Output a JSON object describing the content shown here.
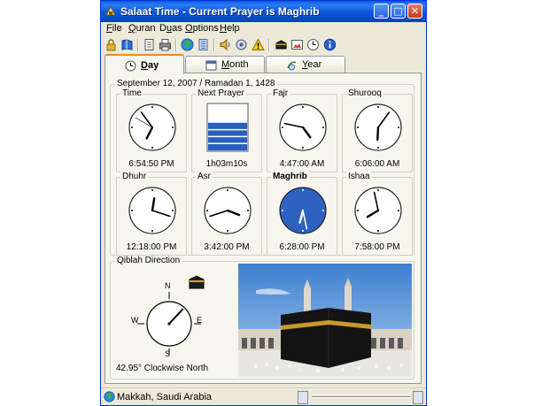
{
  "window": {
    "title": "Salaat Time - Current Prayer is Maghrib"
  },
  "title_buttons": {
    "minimize": "_",
    "maximize": "□",
    "close": "✕"
  },
  "menu": [
    {
      "label": "File",
      "key": "F",
      "rest": "ile"
    },
    {
      "label": "Quran",
      "key": "Q",
      "rest": "uran"
    },
    {
      "label": "Duas",
      "key": "u",
      "pre": "D",
      "rest": "as"
    },
    {
      "label": "Options",
      "key": "O",
      "rest": "ptions"
    },
    {
      "label": "Help",
      "key": "H",
      "rest": "elp"
    }
  ],
  "toolbar": {
    "icons": [
      "lock-icon",
      "book-icon",
      "document-icon",
      "printer-icon",
      "globe-icon",
      "calendar-icon",
      "speaker-icon",
      "sound-settings-icon",
      "warning-icon",
      "kaaba-icon",
      "image-icon",
      "clock-icon",
      "info-icon"
    ]
  },
  "tabs": [
    {
      "label": "Day",
      "key": "D",
      "rest": "ay",
      "icon": "clock-icon",
      "active": true
    },
    {
      "label": "Month",
      "key": "M",
      "rest": "onth",
      "icon": "calendar-icon",
      "active": false
    },
    {
      "label": "Year",
      "key": "Y",
      "rest": "ear",
      "icon": "calendar-year-icon",
      "active": false
    }
  ],
  "date_header": "September 12, 2007 / Ramadan 1, 1428",
  "clocks": [
    {
      "name": "Time",
      "time": "6:54:50 PM",
      "hour": 6,
      "minute": 54,
      "second": 50,
      "style": "normal"
    },
    {
      "name": "Next Prayer",
      "time": "1h03m10s",
      "style": "progress",
      "remaining_fraction": 0.6
    },
    {
      "name": "Fajr",
      "time": "4:47:00 AM",
      "hour": 4,
      "minute": 47,
      "style": "normal"
    },
    {
      "name": "Shurooq",
      "time": "6:06:00 AM",
      "hour": 6,
      "minute": 6,
      "style": "normal"
    },
    {
      "name": "Dhuhr",
      "time": "12:18:00 PM",
      "hour": 12,
      "minute": 18,
      "style": "normal"
    },
    {
      "name": "Asr",
      "time": "3:42:00 PM",
      "hour": 3,
      "minute": 42,
      "style": "normal"
    },
    {
      "name": "Maghrib",
      "time": "6:28:00 PM",
      "hour": 6,
      "minute": 28,
      "style": "active"
    },
    {
      "name": "Ishaa",
      "time": "7:58:00 PM",
      "hour": 7,
      "minute": 58,
      "style": "normal"
    }
  ],
  "qiblah": {
    "label": "Qiblah Direction",
    "direction_text": "42.95° Clockwise North",
    "degrees": 42.95,
    "compass": {
      "n": "N",
      "e": "E",
      "s": "S",
      "w": "W"
    }
  },
  "status": {
    "location": "Makkah, Saudi Arabia"
  },
  "colors": {
    "title_bar": "#0a5ae6",
    "active_clock": "#2f62c0",
    "progress_bar": "#2a5fbf",
    "tab_highlight": "#e68b2c"
  }
}
